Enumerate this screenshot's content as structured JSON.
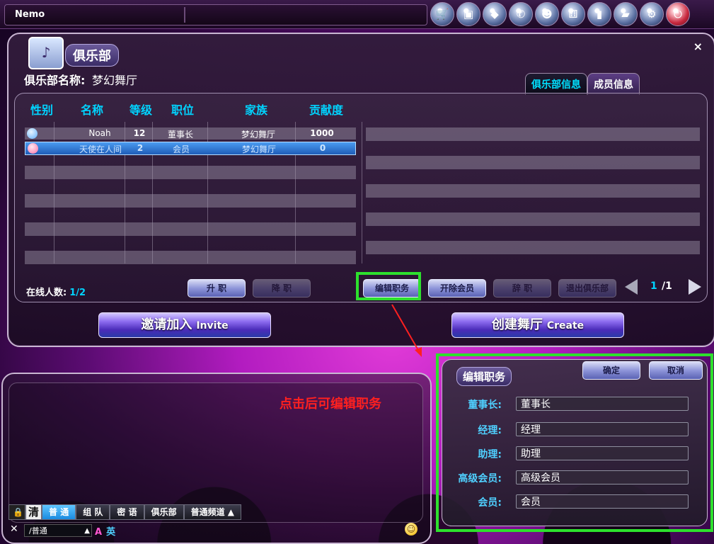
{
  "topbar": {
    "player_name": "Nemo",
    "icons": [
      "shop-icon",
      "photo-icon",
      "item-icon",
      "phone-icon",
      "friends-icon",
      "dice-icon",
      "ranking-icon",
      "folder-icon",
      "settings-icon",
      "power-icon"
    ]
  },
  "club": {
    "title": "俱乐部",
    "name_label": "俱乐部名称:",
    "name_value": "梦幻舞厅",
    "close_label": "×",
    "tabs": [
      "俱乐部信息",
      "成员信息"
    ],
    "columns": [
      "性别",
      "名称",
      "等级",
      "职位",
      "家族",
      "贡献度"
    ],
    "members": [
      {
        "name": "Noah",
        "level": "12",
        "position": "董事长",
        "family": "梦幻舞厅",
        "contribution": "1000"
      },
      {
        "name": "天使在人间",
        "level": "2",
        "position": "会员",
        "family": "梦幻舞厅",
        "contribution": "0"
      }
    ],
    "online_label": "在线人数:",
    "online_value": "1/2",
    "buttons": {
      "promote": "升 职",
      "demote": "降 职",
      "edit_positions": "编辑职务",
      "expel": "开除会员",
      "resign": "辞 职",
      "quit": "退出俱乐部"
    },
    "page_current": "1",
    "page_total": "/1",
    "invite_cn": "邀请加入",
    "invite_en": "Invite",
    "create_cn": "创建舞厅",
    "create_en": "Create"
  },
  "chat": {
    "annotation": "点击后可编辑职务",
    "clear_label": "清",
    "tabs": [
      "普 通",
      "组 队",
      "密 语",
      "俱乐部",
      "普通频道"
    ],
    "channel_value": "/普通",
    "ime_a": "A",
    "ime_b": "英"
  },
  "edit_panel": {
    "title": "编辑职务",
    "confirm": "确定",
    "cancel": "取消",
    "fields": [
      {
        "label": "董事长:",
        "value": "董事长"
      },
      {
        "label": "经理:",
        "value": "经理"
      },
      {
        "label": "助理:",
        "value": "助理"
      },
      {
        "label": "高级会员:",
        "value": "高级会员"
      },
      {
        "label": "会员:",
        "value": "会员"
      }
    ]
  },
  "colors": {
    "highlight": "#2de02d",
    "accent_cyan": "#00d4ff",
    "annotation_red": "#ff2020"
  }
}
